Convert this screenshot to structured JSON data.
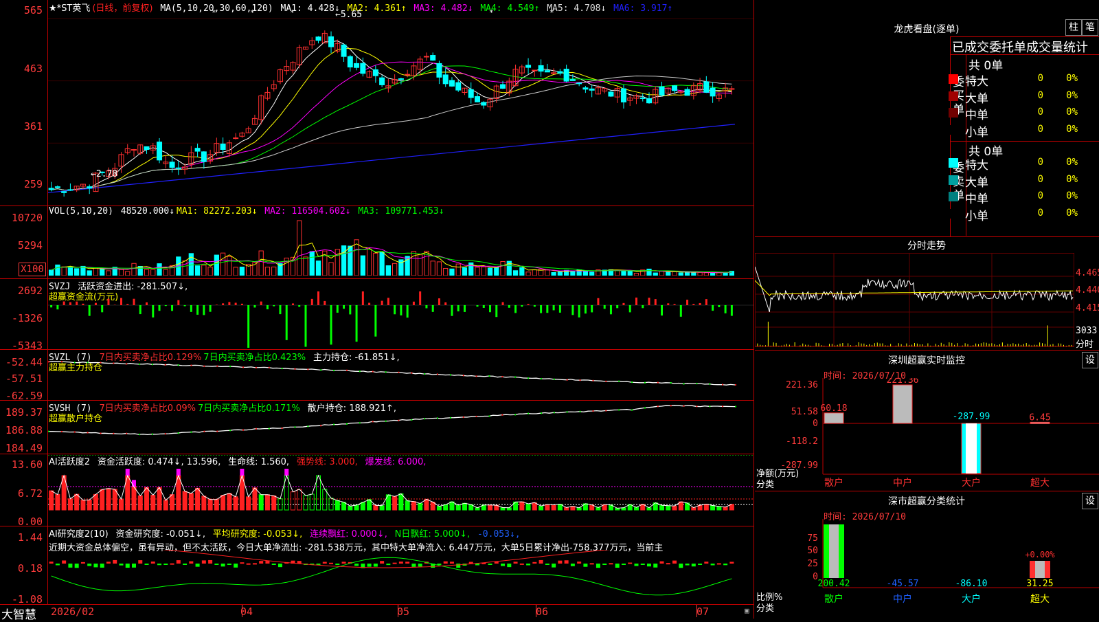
{
  "main_chart": {
    "header": {
      "name": "★*ST英飞",
      "period": "(日线，前复权)",
      "ma_params": "MA(5,10,20,30,60,120)",
      "ma1": "MA1: 4.428↓",
      "ma2": "MA2: 4.361↑",
      "ma3": "MA3: 4.482↓",
      "ma4": "MA4: 4.549↑",
      "ma5": "MA5: 4.708↓",
      "ma6": "MA6: 3.917↑"
    },
    "y_ticks": [
      "565",
      "463",
      "361",
      "259"
    ],
    "high_label": "5.65",
    "low_label": "2.78",
    "stars": [
      "*",
      "*",
      "*",
      "*",
      "*"
    ]
  },
  "vol": {
    "header": {
      "name": "VOL(5,10,20)",
      "value": "48520.000↓",
      "ma1": "MA1: 82272.203↓",
      "ma2": "MA2: 116504.602↓",
      "ma3": "MA3: 109771.453↓"
    },
    "y_ticks": [
      "10720",
      "5294",
      "X100"
    ]
  },
  "svzj": {
    "header": {
      "name": "SVZJ",
      "text": "活跃资金进出: -281.507↓,"
    },
    "subtitle": "超赢资金流(万元)",
    "y_ticks": [
      "2692",
      "-1326",
      "-5343"
    ]
  },
  "svzl": {
    "header": {
      "name": "SVZL (7)",
      "a": "7日内买卖净占比0.129%",
      "b": "7日内买卖净占比0.423%",
      "c": "主力持仓: -61.851↓,"
    },
    "subtitle": "超赢主力持仓",
    "y_ticks": [
      "-52.44",
      "-57.51",
      "-62.59"
    ]
  },
  "svsh": {
    "header": {
      "name": "SVSH (7)",
      "a": "7日内买卖净占比0.09%",
      "b": "7日内买卖净占比0.171%",
      "c": "散户持仓: 188.921↑,"
    },
    "subtitle": "超赢散户持仓",
    "y_ticks": [
      "189.37",
      "186.88",
      "184.49"
    ]
  },
  "ai1": {
    "header": {
      "name": "AI活跃度2",
      "a": "资金活跃度: 0.474↓, 13.596,",
      "b": "生命线: 1.560,",
      "c": "强势线: 3.000,",
      "d": "爆发线: 6.000,"
    },
    "y_ticks": [
      "13.60",
      "6.72",
      "0.00"
    ]
  },
  "ai2": {
    "header": {
      "name": "AI研究度2(10)",
      "a": "资金研究度: -0.051↓,",
      "b": "平均研究度: -0.053↓,",
      "c": "连续飘红: 0.000↓,",
      "d": "N日飘红: 5.000↓,",
      "e": "-0.053↓,"
    },
    "comment": "近期大资金总体偏空，虽有异动，但不太活跃，今日大单净流出: -281.538万元，其中特大单净流入: 6.447万元，大单5日累计净出-758.377万元，当前主",
    "y_ticks": [
      "1.44",
      "0.18",
      "-1.08"
    ]
  },
  "x_axis": {
    "labels": [
      "2026/02",
      "04",
      "05",
      "06",
      "07"
    ],
    "brand": "大智慧"
  },
  "right_panel": {
    "lhb": {
      "title": "龙虎看盘(逐单)",
      "btn_zhu": "柱",
      "btn_bi": "笔",
      "header": "已成交委托单成交量统计",
      "buy_label": "委买单",
      "sell_label": "委卖单",
      "buy_total": "共 0单",
      "sell_total": "共 0单",
      "buy_rows": [
        {
          "label": "特大",
          "count": "0",
          "pct": "0%",
          "color": "#ff0000"
        },
        {
          "label": "大单",
          "count": "0",
          "pct": "0%",
          "color": "#a00000"
        },
        {
          "label": "中单",
          "count": "0",
          "pct": "0%",
          "color": "#700000"
        },
        {
          "label": "小单",
          "count": "0",
          "pct": "0%",
          "color": "#000000"
        }
      ],
      "sell_rows": [
        {
          "label": "特大",
          "count": "0",
          "pct": "0%",
          "color": "#00ffff"
        },
        {
          "label": "大单",
          "count": "0",
          "pct": "0%",
          "color": "#00a0a0"
        },
        {
          "label": "中单",
          "count": "0",
          "pct": "0%",
          "color": "#008080"
        },
        {
          "label": "小单",
          "count": "0",
          "pct": "0%",
          "color": "#000000"
        }
      ]
    },
    "fenshi": {
      "title": "分时走势",
      "y_ticks": [
        "4.465",
        "4.440",
        "4.415"
      ],
      "vol_tick": "3033",
      "vol_unit": "分时"
    },
    "monitor": {
      "title": "深圳超赢实时监控",
      "btn": "设",
      "time": "时间: 2026/07/10",
      "y_ticks": [
        "221.36",
        "51.58",
        "0",
        "-118.2",
        "-287.99"
      ],
      "unit": "净额(万元)",
      "cat_label": "分类",
      "categories": [
        "散户",
        "中户",
        "大户",
        "超大"
      ],
      "bar_labels": [
        "60.18",
        "221.36",
        "-287.99",
        "6.45"
      ]
    },
    "classify": {
      "title": "深市超赢分类统计",
      "btn": "设",
      "time": "时间: 2026/07/10",
      "y_ticks": [
        "75",
        "50",
        "25",
        "0"
      ],
      "unit": "比例%",
      "cat_label": "分类",
      "categories": [
        "散户",
        "中户",
        "大户",
        "超大"
      ],
      "values": [
        "200.42",
        "-45.57",
        "-86.10",
        "31.25"
      ],
      "top_label": "+0.00%"
    }
  },
  "chart_data": [
    {
      "type": "candlestick",
      "title": "★*ST英飞",
      "ylim": [
        2.59,
        5.75
      ],
      "x_labels": [
        "2026/02",
        "04",
        "05",
        "06",
        "07"
      ],
      "high": 5.65,
      "low": 2.78
    },
    {
      "type": "bar",
      "title": "VOL(5,10,20)"
    },
    {
      "type": "bar",
      "title": "SVZJ"
    },
    {
      "type": "line",
      "title": "SVZL (7)"
    },
    {
      "type": "line",
      "title": "SVSH (7)"
    },
    {
      "type": "bar",
      "title": "AI活跃度2"
    },
    {
      "type": "bar",
      "title": "AI研究度2(10)"
    },
    {
      "type": "bar",
      "title": "深圳超赢实时监控",
      "categories": [
        "散户",
        "中户",
        "大户",
        "超大"
      ],
      "values": [
        60.18,
        221.36,
        -287.99,
        6.45
      ]
    },
    {
      "type": "bar",
      "title": "深市超赢分类统计",
      "categories": [
        "散户",
        "中户",
        "大户",
        "超大"
      ],
      "values": [
        200.42,
        -45.57,
        -86.1,
        31.25
      ]
    }
  ]
}
